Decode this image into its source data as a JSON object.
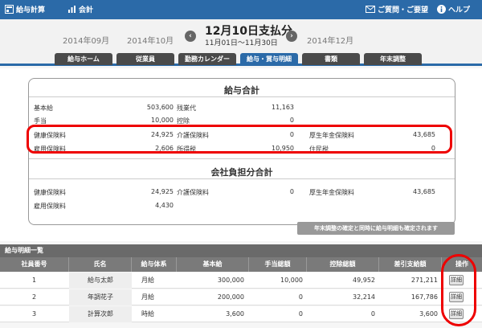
{
  "topbar": {
    "app_name": "給与計算",
    "accounting": "会計",
    "contact": "ご質問・ご要望",
    "help": "ヘルプ",
    "bg": "#2b6aa8"
  },
  "month_nav": {
    "prev2": "2014年09月",
    "prev1": "2014年10月",
    "title": "12月10日支払分",
    "subtitle": "11月01日〜11月30日",
    "next1": "2014年12月"
  },
  "tabs": [
    {
      "label": "給与ホーム"
    },
    {
      "label": "従業員"
    },
    {
      "label": "勤務カレンダー"
    },
    {
      "label": "給与・賞与明細"
    },
    {
      "label": "書類"
    },
    {
      "label": "年末調整"
    }
  ],
  "salary_total": {
    "title": "給与合計",
    "rows": [
      [
        {
          "k": "基本給",
          "v": "503,600"
        },
        {
          "k": "残業代",
          "v": "11,163"
        },
        {
          "k": "",
          "v": ""
        }
      ],
      [
        {
          "k": "手当",
          "v": "10,000"
        },
        {
          "k": "控除",
          "v": "0"
        },
        {
          "k": "",
          "v": ""
        }
      ],
      [
        {
          "k": "健康保険料",
          "v": "24,925"
        },
        {
          "k": "介護保険料",
          "v": "0"
        },
        {
          "k": "厚生年金保険料",
          "v": "43,685"
        }
      ],
      [
        {
          "k": "雇用保険料",
          "v": "2,606"
        },
        {
          "k": "所得税",
          "v": "10,950"
        },
        {
          "k": "住民税",
          "v": "0"
        }
      ]
    ]
  },
  "company_total": {
    "title": "会社負担分合計",
    "rows": [
      [
        {
          "k": "健康保険料",
          "v": "24,925"
        },
        {
          "k": "介護保険料",
          "v": "0"
        },
        {
          "k": "厚生年金保険料",
          "v": "43,685"
        }
      ],
      [
        {
          "k": "雇用保険料",
          "v": "4,430"
        },
        {
          "k": "",
          "v": ""
        },
        {
          "k": "",
          "v": ""
        }
      ]
    ]
  },
  "notice": "年末調整の確定と同時に給与明細も確定されます",
  "list": {
    "header": "給与明細一覧",
    "columns": [
      "社員番号",
      "氏名",
      "給与体系",
      "基本給",
      "手当総額",
      "控除総額",
      "差引支給額",
      "操作"
    ],
    "rows": [
      {
        "id": "1",
        "name": "給与太郎",
        "type": "月給",
        "base": "300,000",
        "allowance": "10,000",
        "deduction": "49,952",
        "net": "271,211",
        "action": "詳細"
      },
      {
        "id": "2",
        "name": "年調花子",
        "type": "月給",
        "base": "200,000",
        "allowance": "0",
        "deduction": "32,214",
        "net": "167,786",
        "action": "詳細"
      },
      {
        "id": "3",
        "name": "計算次郎",
        "type": "時給",
        "base": "3,600",
        "allowance": "0",
        "deduction": "0",
        "net": "3,600",
        "action": "詳細"
      }
    ]
  },
  "highlight_color": "#ee0000"
}
